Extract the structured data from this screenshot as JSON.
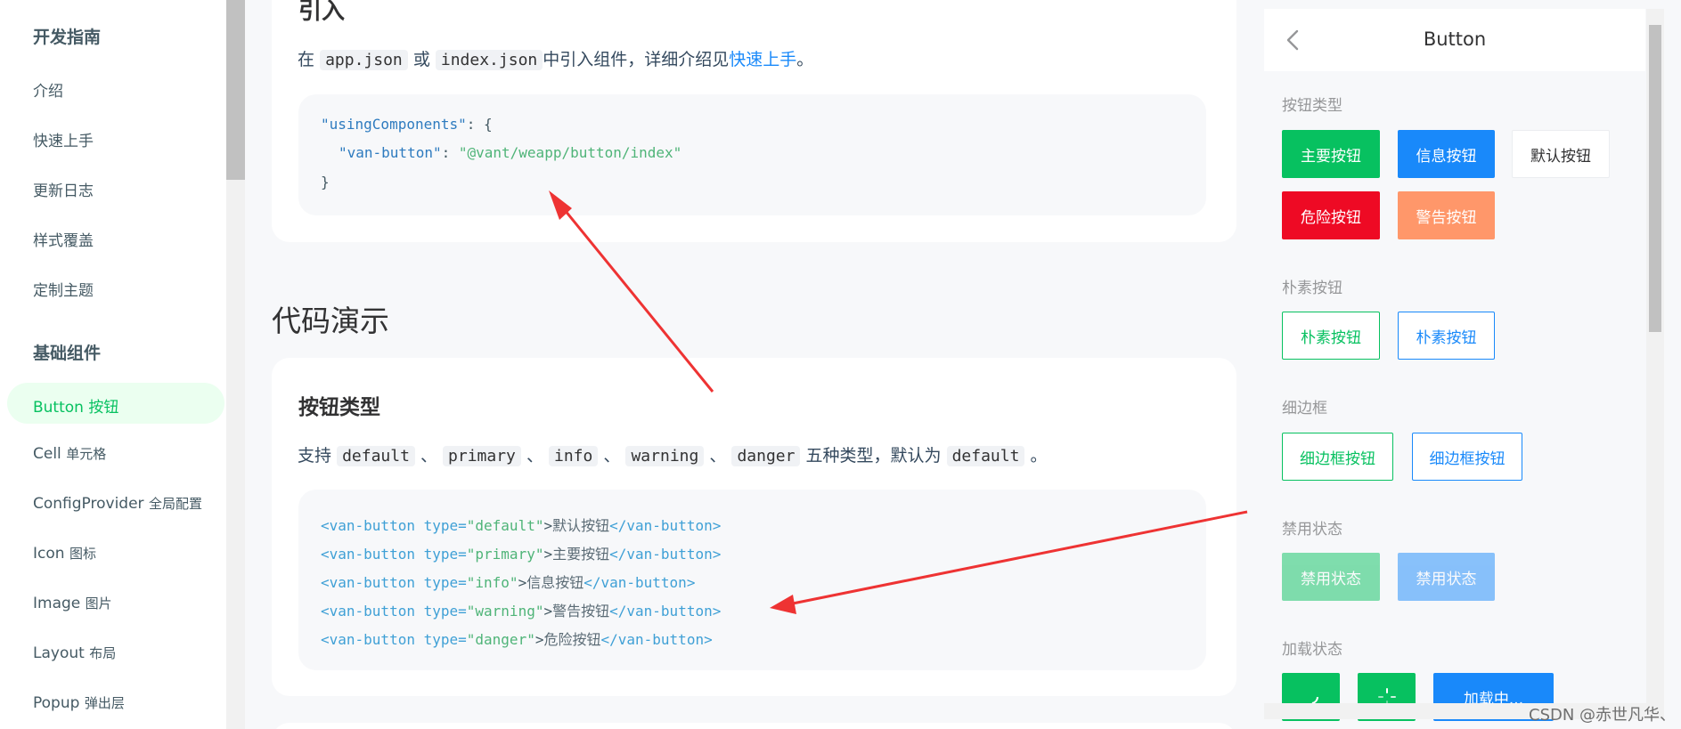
{
  "sidebar": {
    "group1": "开发指南",
    "items1": [
      "介绍",
      "快速上手",
      "更新日志",
      "样式覆盖",
      "定制主题"
    ],
    "group2": "基础组件",
    "active": "Button 按钮",
    "items2": [
      {
        "en": "Cell",
        "zh": "单元格"
      },
      {
        "en": "ConfigProvider",
        "zh": "全局配置"
      },
      {
        "en": "Icon",
        "zh": "图标"
      },
      {
        "en": "Image",
        "zh": "图片"
      },
      {
        "en": "Layout",
        "zh": "布局"
      },
      {
        "en": "Popup",
        "zh": "弹出层"
      }
    ]
  },
  "intro": {
    "heading": "引入",
    "p_pre": "在",
    "code1": "app.json",
    "p_or": "或",
    "code2": "index.json",
    "p_mid": "中引入组件，详细介绍见",
    "link": "快速上手",
    "p_end": "。",
    "code": {
      "l1_key": "\"usingComponents\"",
      "l1_rest": ": {",
      "l2_key": "\"van-button\"",
      "l2_colon": ": ",
      "l2_val": "\"@vant/weapp/button/index\"",
      "l3": "}"
    }
  },
  "demo": {
    "title": "代码演示",
    "heading": "按钮类型",
    "p_pre": "支持",
    "types": [
      "default",
      "primary",
      "info",
      "warning",
      "danger"
    ],
    "sep": "、",
    "p_mid": "五种类型，默认为",
    "p_default": "default",
    "p_end": "。",
    "lines": [
      {
        "type": "\"default\"",
        "text": "默认按钮"
      },
      {
        "type": "\"primary\"",
        "text": "主要按钮"
      },
      {
        "type": "\"info\"",
        "text": "信息按钮"
      },
      {
        "type": "\"warning\"",
        "text": "警告按钮"
      },
      {
        "type": "\"danger\"",
        "text": "危险按钮"
      }
    ],
    "tag_open": "<van-button",
    "attr": " type=",
    "gt": ">",
    "tag_close": "</van-button>"
  },
  "phone": {
    "title": "Button",
    "sec1": "按钮类型",
    "btn_primary": "主要按钮",
    "btn_info": "信息按钮",
    "btn_default": "默认按钮",
    "btn_danger": "危险按钮",
    "btn_warning": "警告按钮",
    "sec2": "朴素按钮",
    "plain1": "朴素按钮",
    "plain2": "朴素按钮",
    "sec3": "细边框",
    "hair1": "细边框按钮",
    "hair2": "细边框按钮",
    "sec4": "禁用状态",
    "dis1": "禁用状态",
    "dis2": "禁用状态",
    "sec5": "加载状态",
    "loading_text": "加载中..."
  },
  "colors": {
    "primary": "#07c160",
    "info": "#1989fa",
    "danger": "#ee0a24",
    "warning": "#ff976a",
    "annotation": "#ee3333"
  },
  "watermark": "CSDN @赤世凡华、"
}
